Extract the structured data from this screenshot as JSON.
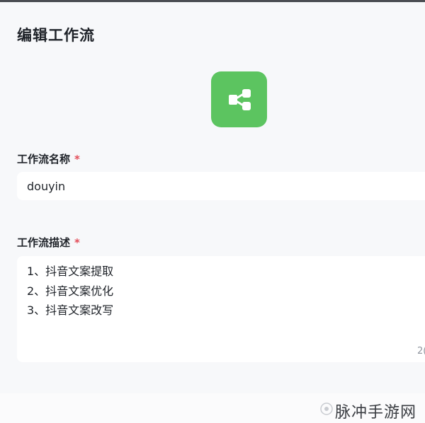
{
  "dialog": {
    "title": "编辑工作流",
    "icon": "workflow-share-icon",
    "icon_color": "#5cc460",
    "name_field": {
      "label": "工作流名称",
      "required_mark": "*",
      "value": "douyin"
    },
    "description_field": {
      "label": "工作流描述",
      "required_mark": "*",
      "lines": [
        "1、抖音文案提取",
        "2、抖音文案优化",
        "3、抖音文案改写"
      ],
      "counter": "2("
    }
  },
  "watermark": {
    "text": "脉冲手游网"
  },
  "colors": {
    "required": "#e34d59",
    "text": "#1f2329",
    "background": "#f7f8fa"
  }
}
